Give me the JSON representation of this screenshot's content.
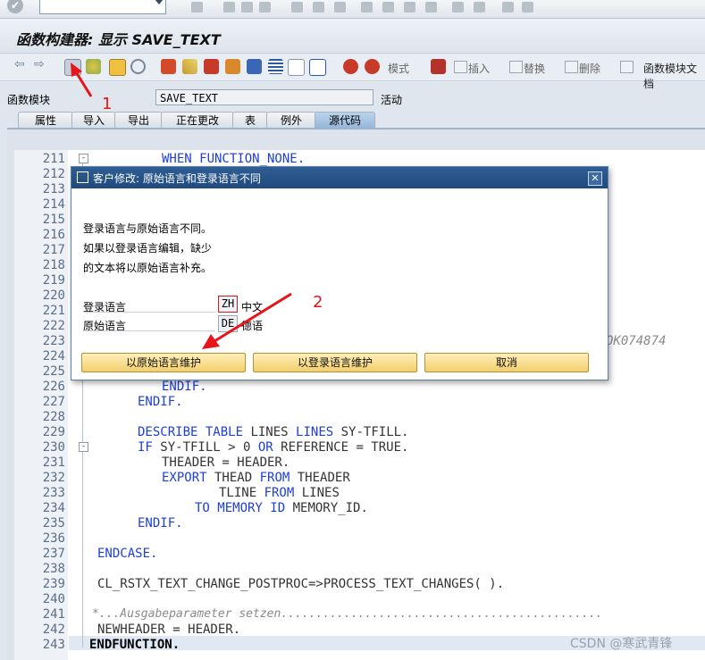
{
  "window": {
    "title": "函数构建器: 显示 SAVE_TEXT"
  },
  "app_toolbar": {
    "mode_label": "模式",
    "insert_label": "插入",
    "replace_label": "替换",
    "delete_label": "删除",
    "doc_label": "函数模块文档"
  },
  "header": {
    "function_module_label": "函数模块",
    "function_module_value": "SAVE_TEXT",
    "status": "活动"
  },
  "tabs": [
    {
      "label": "属性",
      "active": false
    },
    {
      "label": "导入",
      "active": false
    },
    {
      "label": "导出",
      "active": false
    },
    {
      "label": "正在更改",
      "active": false
    },
    {
      "label": "表",
      "active": false
    },
    {
      "label": "例外",
      "active": false
    },
    {
      "label": "源代码",
      "active": true
    }
  ],
  "editor": {
    "line_numbers": [
      "211",
      "212",
      "213",
      "214",
      "215",
      "216",
      "217",
      "218",
      "219",
      "220",
      "221",
      "222",
      "223",
      "224",
      "225",
      "226",
      "227",
      "228",
      "229",
      "230",
      "231",
      "232",
      "233",
      "234",
      "235",
      "236",
      "237",
      "238",
      "239",
      "240",
      "241",
      "242",
      "243"
    ],
    "visible_code": {
      "l211": "WHEN FUNCTION_NONE.",
      "l223_partial": "OK074874",
      "l226": "ENDIF.",
      "l227": "ENDIF.",
      "l229a": "DESCRIBE TABLE",
      "l229b": " LINES ",
      "l229c": "LINES",
      "l229d": " SY-TFILL.",
      "l230a": "IF",
      "l230b": " SY-TFILL > 0 ",
      "l230c": "OR",
      "l230d": " REFERENCE = TRUE.",
      "l231": "THEADER = HEADER.",
      "l232a": "EXPORT",
      "l232b": " THEAD ",
      "l232c": "FROM",
      "l232d": " THEADER",
      "l233a": "TLINE ",
      "l233b": "FROM",
      "l233c": " LINES",
      "l234a": "TO MEMORY ID",
      "l234b": " MEMORY_ID.",
      "l235": "ENDIF.",
      "l237": "ENDCASE.",
      "l239": "CL_RSTX_TEXT_CHANGE_POSTPROC=>PROCESS_TEXT_CHANGES( ).",
      "l241": "*...Ausgabeparameter setzen..............................................",
      "l242": "NEWHEADER = HEADER.",
      "l243": "ENDFUNCTION."
    }
  },
  "dialog": {
    "title": "客户修改: 原始语言和登录语言不同",
    "message_line1": "登录语言与原始语言不同。",
    "message_line2": "如果以登录语言编辑，缺少",
    "message_line3": "的文本将以原始语言补充。",
    "login_lang_label": "登录语言",
    "login_lang_code": "ZH",
    "login_lang_name": "中文",
    "orig_lang_label": "原始语言",
    "orig_lang_code": "DE",
    "orig_lang_name": "德语",
    "buttons": {
      "orig": "以原始语言维护",
      "login": "以登录语言维护",
      "cancel": "取消"
    }
  },
  "annotations": {
    "step1": "1",
    "step2": "2",
    "arrow_color": "#e8141c"
  },
  "watermark": "CSDN @寒武青锋"
}
